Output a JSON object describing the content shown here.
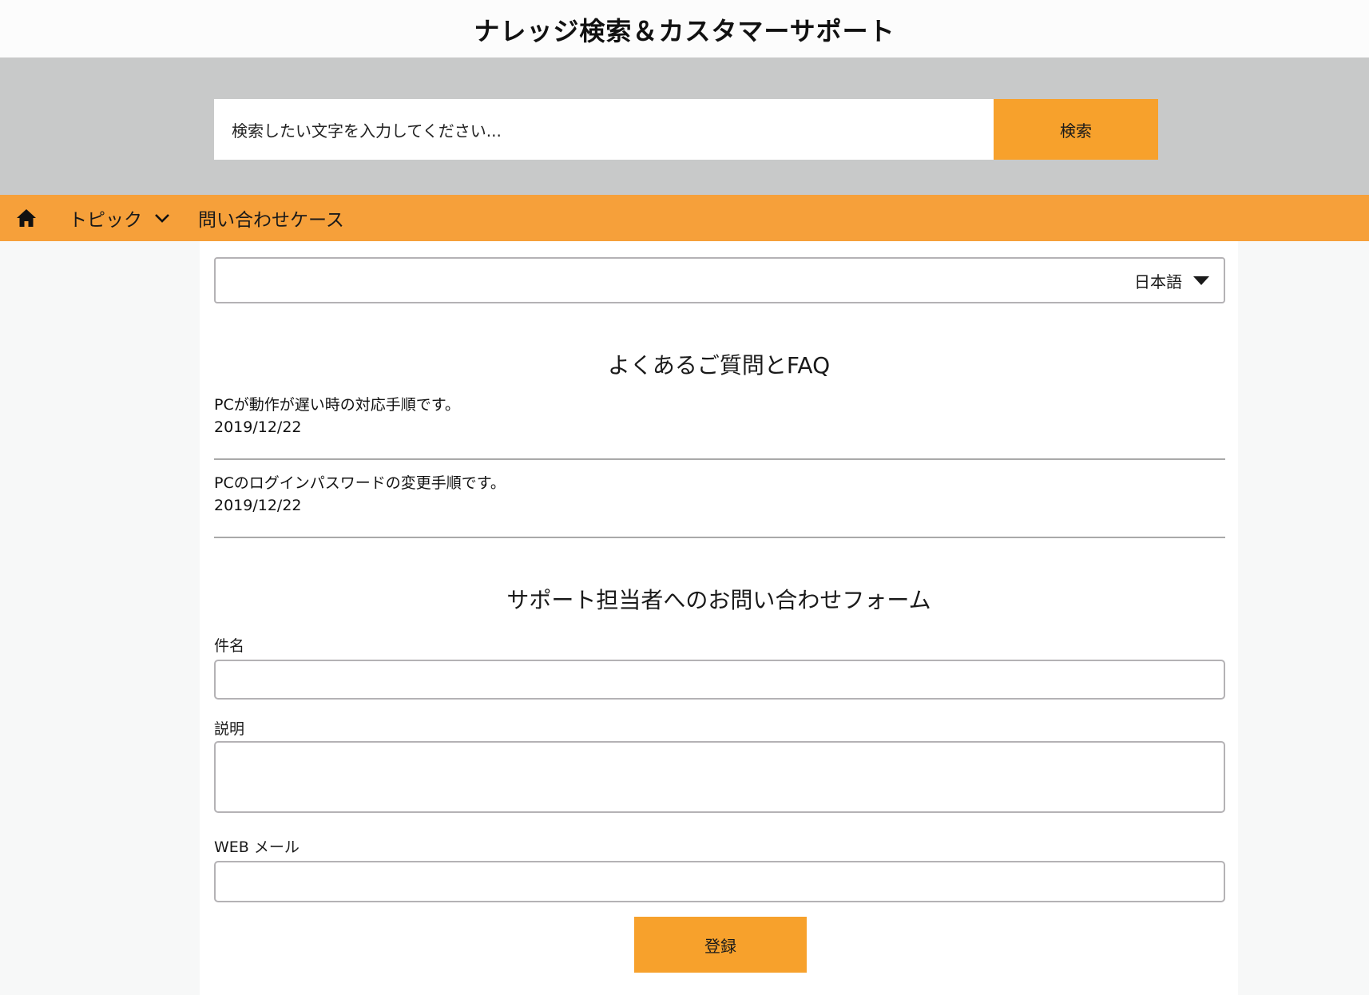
{
  "header": {
    "title": "ナレッジ検索＆カスタマーサポート"
  },
  "search": {
    "placeholder": "検索したい文字を入力してください...",
    "button_label": "検索"
  },
  "nav": {
    "home_icon": "home-icon",
    "topic_label": "トピック",
    "topic_icon": "chevron-down-icon",
    "cases_label": "問い合わせケース"
  },
  "language": {
    "selected": "日本語"
  },
  "faq": {
    "title": "よくあるご質問とFAQ",
    "items": [
      {
        "title": "PCが動作が遅い時の対応手順です。",
        "date": "2019/12/22"
      },
      {
        "title": "PCのログインパスワードの変更手順です。",
        "date": "2019/12/22"
      }
    ]
  },
  "form": {
    "title": "サポート担当者へのお問い合わせフォーム",
    "subject_label": "件名",
    "subject_value": "",
    "description_label": "説明",
    "description_value": "",
    "email_label": "WEB メール",
    "email_value": "",
    "submit_label": "登録"
  },
  "colors": {
    "accent": "#f7a12c",
    "nav": "#f6a03a",
    "search_band": "#c8c9c9"
  }
}
